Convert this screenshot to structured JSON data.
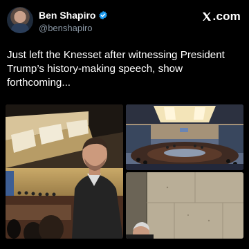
{
  "post": {
    "author_name": "Ben Shapiro",
    "author_handle": "@benshapiro",
    "verified": true,
    "platform_label": ".com",
    "text": "Just left the Knesset after witnessing President Trump’s history-making speech, show forthcoming..."
  },
  "icons": {
    "verified": "verified-badge-icon",
    "platform": "x-logo-icon"
  },
  "colors": {
    "background": "#000000",
    "text": "#ffffff",
    "handle": "#8b98a5",
    "verified_badge": "#1d9bf0"
  }
}
